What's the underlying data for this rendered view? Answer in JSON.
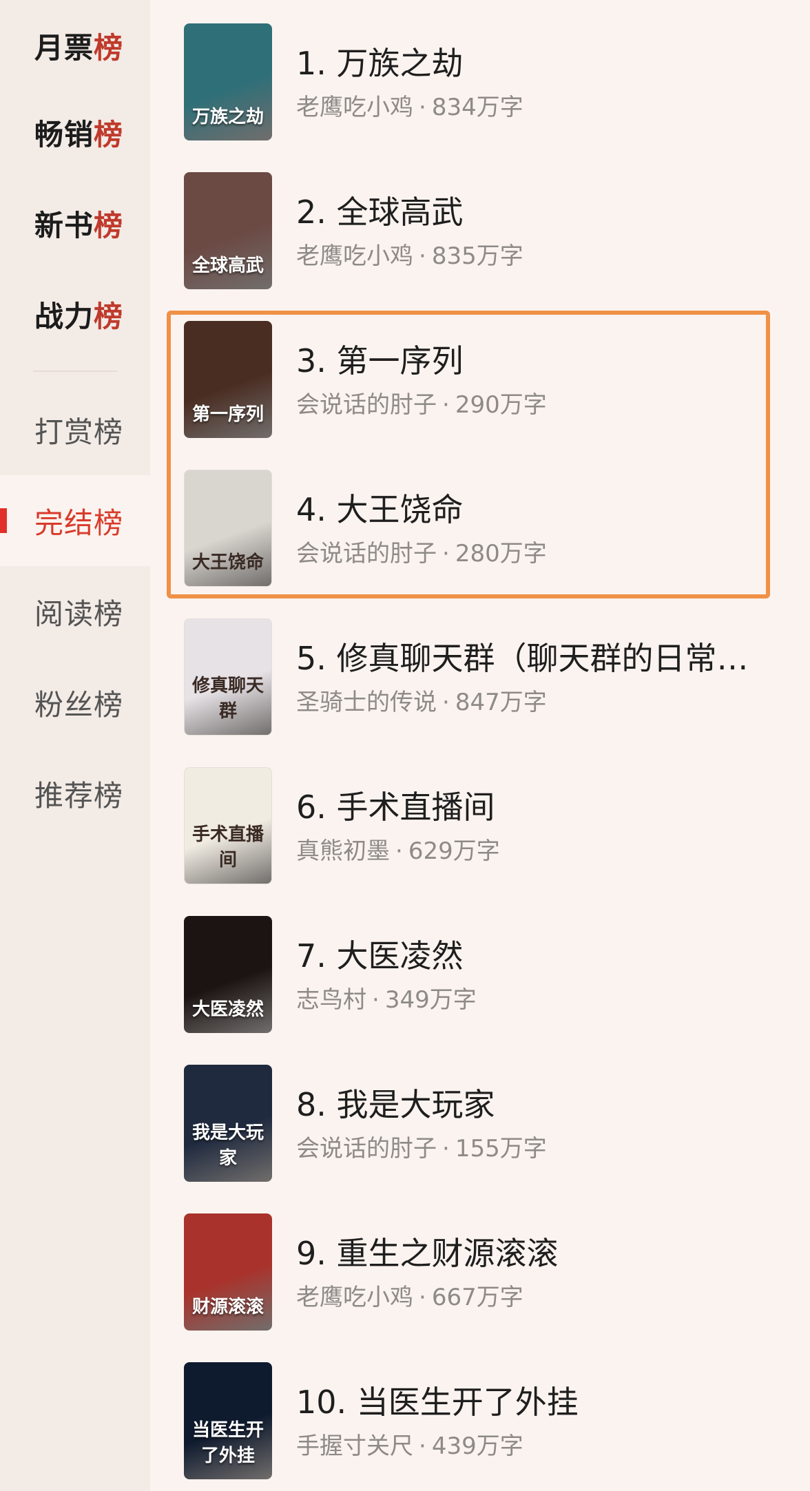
{
  "sidebar": {
    "items": [
      {
        "prefix": "月票",
        "suffix": "榜",
        "style": "bold"
      },
      {
        "prefix": "畅销",
        "suffix": "榜",
        "style": "bold"
      },
      {
        "prefix": "新书",
        "suffix": "榜",
        "style": "bold"
      },
      {
        "prefix": "战力",
        "suffix": "榜",
        "style": "bold"
      },
      {
        "prefix": "打赏榜",
        "suffix": "",
        "style": "normal"
      },
      {
        "prefix": "完结榜",
        "suffix": "",
        "style": "active"
      },
      {
        "prefix": "阅读榜",
        "suffix": "",
        "style": "normal"
      },
      {
        "prefix": "粉丝榜",
        "suffix": "",
        "style": "normal"
      },
      {
        "prefix": "推荐榜",
        "suffix": "",
        "style": "normal"
      }
    ]
  },
  "books": [
    {
      "title": "1. 万族之劫",
      "author": "老鹰吃小鸡",
      "words": "834万字",
      "cover_text": "万族之劫",
      "cover_color": "#2f6f78"
    },
    {
      "title": "2. 全球高武",
      "author": "老鹰吃小鸡",
      "words": "835万字",
      "cover_text": "全球高武",
      "cover_color": "#6c4a44"
    },
    {
      "title": "3. 第一序列",
      "author": "会说话的肘子",
      "words": "290万字",
      "cover_text": "第一序列",
      "cover_color": "#4a2d22"
    },
    {
      "title": "4. 大王饶命",
      "author": "会说话的肘子",
      "words": "280万字",
      "cover_text": "大王饶命",
      "cover_color": "#d9d5cf"
    },
    {
      "title": "5. 修真聊天群（聊天群的日常…",
      "author": "圣骑士的传说",
      "words": "847万字",
      "cover_text": "修真聊天群",
      "cover_color": "#e6e2e6"
    },
    {
      "title": "6. 手术直播间",
      "author": "真熊初墨",
      "words": "629万字",
      "cover_text": "手术直播间",
      "cover_color": "#f1ece2"
    },
    {
      "title": "7. 大医凌然",
      "author": "志鸟村",
      "words": "349万字",
      "cover_text": "大医凌然",
      "cover_color": "#1c1412"
    },
    {
      "title": "8. 我是大玩家",
      "author": "会说话的肘子",
      "words": "155万字",
      "cover_text": "我是大玩家",
      "cover_color": "#1f2a3f"
    },
    {
      "title": "9. 重生之财源滚滚",
      "author": "老鹰吃小鸡",
      "words": "667万字",
      "cover_text": "财源滚滚",
      "cover_color": "#a9332c"
    },
    {
      "title": "10. 当医生开了外挂",
      "author": "手握寸关尺",
      "words": "439万字",
      "cover_text": "当医生开了外挂",
      "cover_color": "#0e1a2e"
    }
  ],
  "meta_separator": "·",
  "highlight_color": "#ef9146"
}
